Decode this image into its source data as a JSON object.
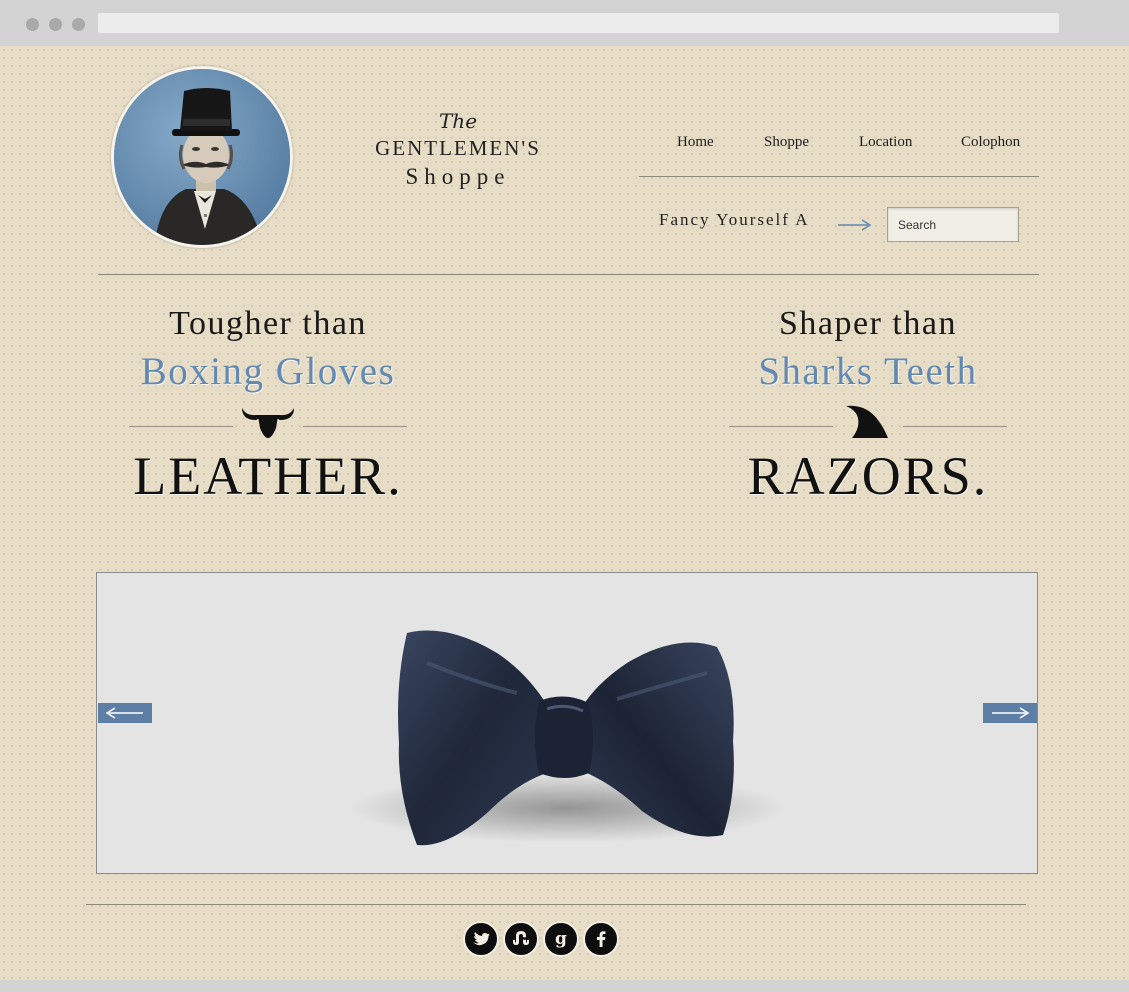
{
  "logo": {
    "the": "The",
    "main": "GENTLEMEN'S",
    "sub": "Shoppe"
  },
  "nav": {
    "items": [
      {
        "label": "Home"
      },
      {
        "label": "Shoppe"
      },
      {
        "label": "Location"
      },
      {
        "label": "Colophon"
      }
    ]
  },
  "tagline": "Fancy Yourself A",
  "search": {
    "placeholder": "Search"
  },
  "promos": [
    {
      "lead": "Tougher than",
      "accent": "Boxing Gloves",
      "word": "LEATHER.",
      "icon": "bull-horns-icon"
    },
    {
      "lead": "Shaper than",
      "accent": "Sharks Teeth",
      "word": "RAZORS.",
      "icon": "shark-fin-icon"
    }
  ],
  "slider": {
    "image": "bow-tie",
    "prev_icon": "arrow-left-icon",
    "next_icon": "arrow-right-icon"
  },
  "social": [
    {
      "icon": "twitter-icon"
    },
    {
      "icon": "stumbleupon-icon"
    },
    {
      "icon": "google-icon"
    },
    {
      "icon": "facebook-icon"
    }
  ],
  "colors": {
    "accent_blue": "#6189b2",
    "button_blue": "#5e7fa5",
    "background": "#e7dcc5",
    "text": "#1a1a1a"
  }
}
